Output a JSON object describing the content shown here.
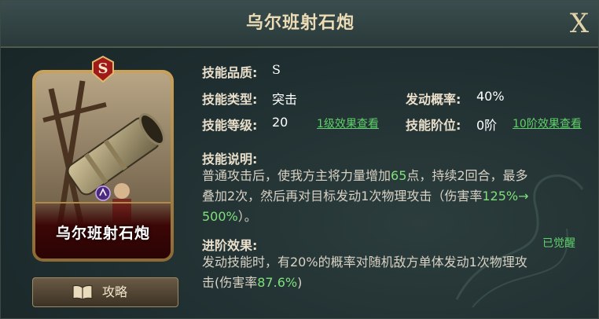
{
  "title": "乌尔班射石炮",
  "close_label": "X",
  "card": {
    "name": "乌尔班射石炮",
    "tier": "S"
  },
  "guide_button": {
    "label": "攻略",
    "icon": "book-icon"
  },
  "info": {
    "quality_label": "技能品质:",
    "quality_value": "S",
    "type_label": "技能类型:",
    "type_value": "突击",
    "prob_label": "发动概率:",
    "prob_value": "40%",
    "level_label": "技能等级:",
    "level_value": "20",
    "level_link": "1级效果查看",
    "rank_label": "技能阶位:",
    "rank_value": "0阶",
    "rank_link": "10阶效果查看"
  },
  "description": {
    "heading": "技能说明:",
    "l1a": "普通攻击后，使我方主将力量增加",
    "l1b": "65",
    "l1c": "点，持续2回合，最多",
    "l2a": "叠加2次，然后再对目标发动1次物理攻击（伤害率",
    "l2b": "125%→",
    "l3a": "500%",
    "l3b": "）。"
  },
  "advance": {
    "heading": "进阶效果:",
    "status": "已觉醒",
    "l1": "发动技能时，有20%的概率对随机敌方单体发动1次物理攻",
    "l2a": "击(伤害率",
    "l2b": "87.6%",
    "l2c": ")"
  },
  "colors": {
    "accent_green": "#5fd06a",
    "highlight_green": "#7fe07a",
    "title_gold": "#ecdcb6",
    "card_red": "#3c0606"
  }
}
